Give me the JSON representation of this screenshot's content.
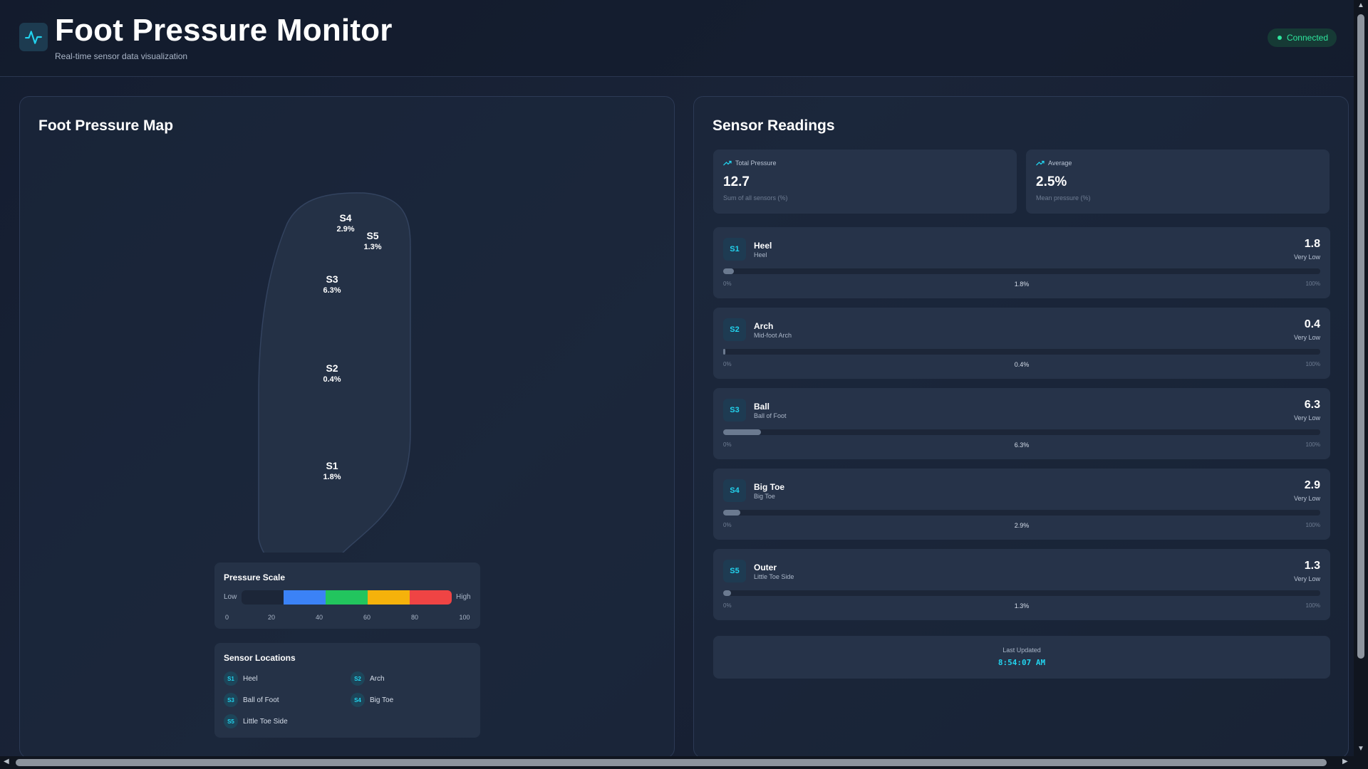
{
  "header": {
    "title": "Foot Pressure Monitor",
    "subtitle": "Real-time sensor data visualization",
    "status": "Connected",
    "logo_icon": "activity-pulse-icon"
  },
  "colors": {
    "accent": "#22d3ee",
    "connected": "#2ee59d",
    "scale": [
      "#1c2638",
      "#3b82f6",
      "#22c55e",
      "#f5b20b",
      "#ef4444"
    ]
  },
  "map": {
    "title": "Foot Pressure Map",
    "markers": [
      {
        "id": "S4",
        "value": "2.9%"
      },
      {
        "id": "S5",
        "value": "1.3%"
      },
      {
        "id": "S3",
        "value": "6.3%"
      },
      {
        "id": "S2",
        "value": "0.4%"
      },
      {
        "id": "S1",
        "value": "1.8%"
      }
    ],
    "scale": {
      "title": "Pressure Scale",
      "low": "Low",
      "high": "High",
      "ticks": [
        "0",
        "20",
        "40",
        "60",
        "80",
        "100"
      ]
    },
    "locations": {
      "title": "Sensor Locations",
      "items": [
        {
          "id": "S1",
          "label": "Heel"
        },
        {
          "id": "S2",
          "label": "Arch"
        },
        {
          "id": "S3",
          "label": "Ball of Foot"
        },
        {
          "id": "S4",
          "label": "Big Toe"
        },
        {
          "id": "S5",
          "label": "Little Toe Side"
        }
      ]
    }
  },
  "readings": {
    "title": "Sensor Readings",
    "total": {
      "label": "Total Pressure",
      "value": "12.7",
      "sub": "Sum of all sensors (%)",
      "icon": "trending-up-icon"
    },
    "average": {
      "label": "Average",
      "value": "2.5%",
      "sub": "Mean pressure (%)",
      "icon": "trending-up-icon"
    },
    "sensors": [
      {
        "id": "S1",
        "name": "Heel",
        "location": "Heel",
        "value": "1.8",
        "level": "Very Low",
        "pct_label": "1.8%",
        "pct": 1.8,
        "min": "0%",
        "max": "100%"
      },
      {
        "id": "S2",
        "name": "Arch",
        "location": "Mid-foot Arch",
        "value": "0.4",
        "level": "Very Low",
        "pct_label": "0.4%",
        "pct": 0.4,
        "min": "0%",
        "max": "100%"
      },
      {
        "id": "S3",
        "name": "Ball",
        "location": "Ball of Foot",
        "value": "6.3",
        "level": "Very Low",
        "pct_label": "6.3%",
        "pct": 6.3,
        "min": "0%",
        "max": "100%"
      },
      {
        "id": "S4",
        "name": "Big Toe",
        "location": "Big Toe",
        "value": "2.9",
        "level": "Very Low",
        "pct_label": "2.9%",
        "pct": 2.9,
        "min": "0%",
        "max": "100%"
      },
      {
        "id": "S5",
        "name": "Outer",
        "location": "Little Toe Side",
        "value": "1.3",
        "level": "Very Low",
        "pct_label": "1.3%",
        "pct": 1.3,
        "min": "0%",
        "max": "100%"
      }
    ],
    "updated": {
      "label": "Last Updated",
      "time": "8:54:07 AM"
    }
  }
}
